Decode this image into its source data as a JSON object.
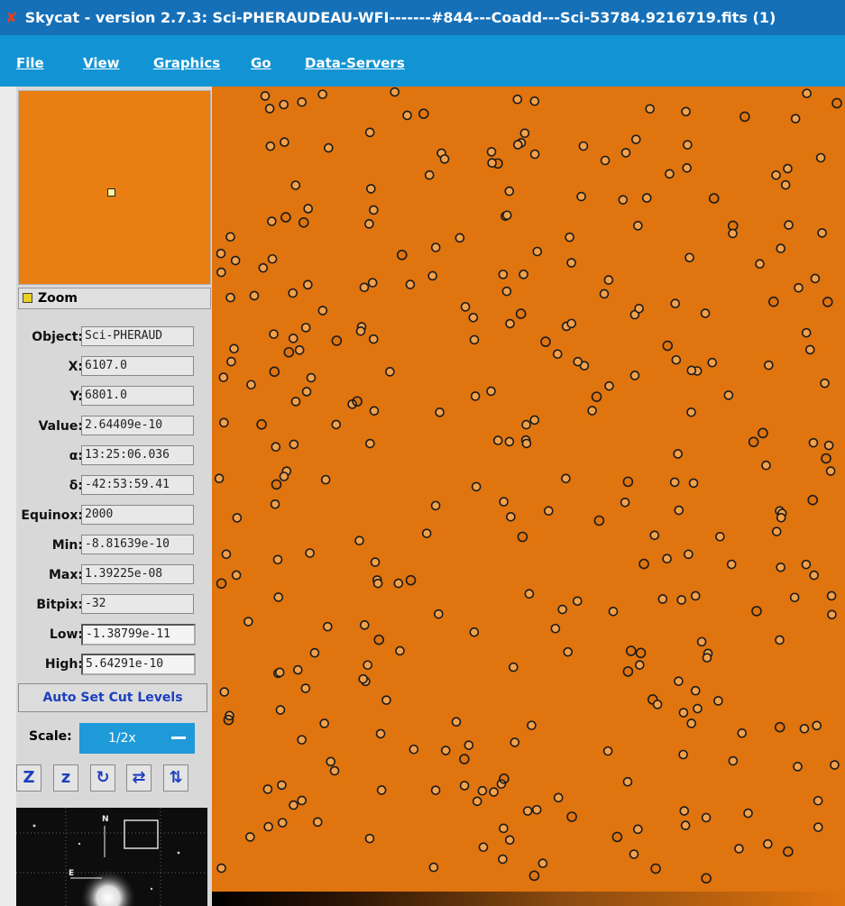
{
  "window": {
    "title": "Skycat - version 2.7.3: Sci-PHERAUDEAU-WFI-------#844---Coadd---Sci-53784.9216719.fits (1)"
  },
  "menu": [
    {
      "label": "File"
    },
    {
      "label": "View"
    },
    {
      "label": "Graphics"
    },
    {
      "label": "Go"
    },
    {
      "label": "Data-Servers"
    }
  ],
  "zoom": {
    "label": "Zoom"
  },
  "info": {
    "object": {
      "label": "Object:",
      "value": "Sci-PHERAUD"
    },
    "x": {
      "label": "X:",
      "value": "6107.0"
    },
    "y": {
      "label": "Y:",
      "value": "6801.0"
    },
    "value": {
      "label": "Value:",
      "value": "2.64409e-10"
    },
    "alpha": {
      "label": "α:",
      "value": "13:25:06.036"
    },
    "delta": {
      "label": "δ:",
      "value": "-42:53:59.41"
    },
    "equinox": {
      "label": "Equinox:",
      "value": "2000"
    },
    "min": {
      "label": "Min:",
      "value": "-8.81639e-10"
    },
    "max": {
      "label": "Max:",
      "value": "1.39225e-08"
    },
    "bitpix": {
      "label": "Bitpix:",
      "value": "-32"
    },
    "low": {
      "label": "Low:",
      "value": "-1.38799e-11"
    },
    "high": {
      "label": "High:",
      "value": "5.64291e-10"
    }
  },
  "autocut": {
    "label": "Auto Set Cut Levels"
  },
  "scale": {
    "label": "Scale:",
    "value": "1/2x"
  },
  "tools": [
    {
      "glyph": "Z",
      "name": "zoom-in-button"
    },
    {
      "glyph": "z",
      "name": "zoom-out-button"
    },
    {
      "glyph": "↻",
      "name": "rotate-button"
    },
    {
      "glyph": "⇄",
      "name": "flip-x-button"
    },
    {
      "glyph": "⇅",
      "name": "flip-y-button"
    }
  ],
  "pan": {
    "n_label": "N",
    "e_label": "E"
  },
  "colors": {
    "image": "#e0740e",
    "title_bar": "#1570b8",
    "menu_bar": "#1294d4",
    "accent_text": "#1b3fbf"
  }
}
